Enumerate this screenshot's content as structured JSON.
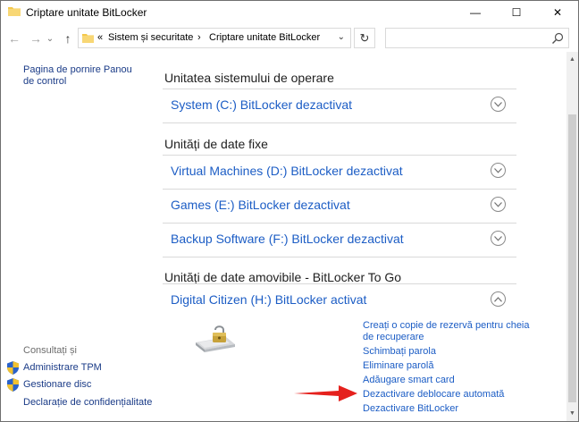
{
  "window": {
    "title": "Criptare unitate BitLocker",
    "minimize_glyph": "—",
    "maximize_glyph": "☐",
    "close_glyph": "✕"
  },
  "nav": {
    "back_glyph": "←",
    "forward_glyph": "→",
    "recent_glyph": "⌄",
    "up_glyph": "↑",
    "refresh_glyph": "↻",
    "address": {
      "overflow": "«",
      "crumbs": [
        "Sistem și securitate",
        "Criptare unitate BitLocker"
      ],
      "separator": "›",
      "dropdown_glyph": "⌄"
    },
    "search_placeholder": ""
  },
  "sidebar": {
    "home_link": "Pagina de pornire Panou de control",
    "see_also_label": "Consultați și",
    "see_also": [
      {
        "label": "Administrare TPM",
        "icon": "shield-icon"
      },
      {
        "label": "Gestionare disc",
        "icon": "shield-icon"
      },
      {
        "label": "Declarație de confidențialitate",
        "icon": ""
      }
    ]
  },
  "main": {
    "sections": [
      {
        "heading": "Unitatea sistemului de operare",
        "drives": [
          {
            "label": "System (C:) BitLocker dezactivat",
            "expanded": false
          }
        ]
      },
      {
        "heading": "Unități de date fixe",
        "drives": [
          {
            "label": "Virtual Machines (D:) BitLocker dezactivat",
            "expanded": false
          },
          {
            "label": "Games (E:) BitLocker dezactivat",
            "expanded": false
          },
          {
            "label": "Backup  Software (F:) BitLocker dezactivat",
            "expanded": false
          }
        ]
      },
      {
        "heading": "Unități de date amovibile - BitLocker To Go",
        "drives": [
          {
            "label": "Digital Citizen (H:) BitLocker activat",
            "expanded": true
          }
        ]
      }
    ],
    "expanded_actions": [
      "Creați o copie de rezervă pentru cheia de recuperare",
      "Schimbați parola",
      "Eliminare parolă",
      "Adăugare smart card",
      "Dezactivare deblocare automată",
      "Dezactivare BitLocker"
    ],
    "highlighted_action_index": 4
  },
  "colors": {
    "link": "#1c5dc5",
    "nav_link": "#1a3b87",
    "annotation_arrow": "#e5211d",
    "folder": "#f4c84b"
  }
}
